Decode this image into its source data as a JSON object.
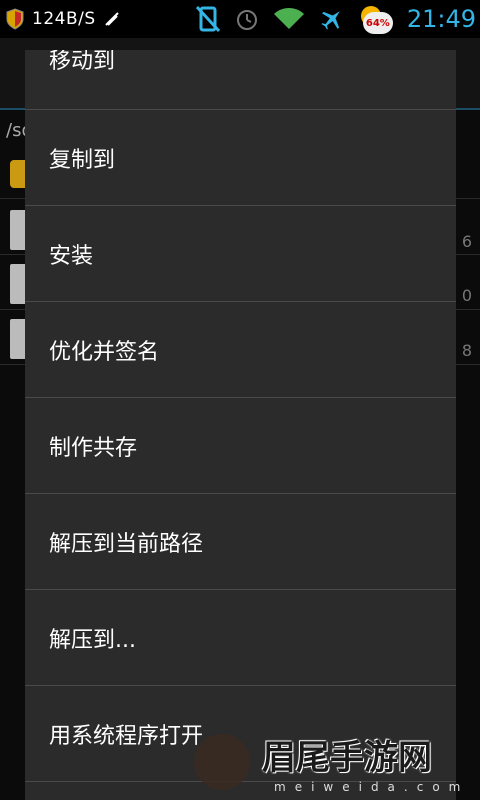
{
  "status_bar": {
    "net_speed": "124B/S",
    "battery_percent": "64%",
    "time": "21:49",
    "icons": [
      "shield-icon",
      "image-icon",
      "usb-icon",
      "mute-icon",
      "alarm-icon",
      "wifi-icon",
      "airplane-icon",
      "weather-icon"
    ],
    "time_color": "#33b5e5"
  },
  "background": {
    "path": "/sd",
    "sizes": [
      "6",
      "0",
      "8"
    ]
  },
  "menu": {
    "items": [
      "移动到",
      "复制到",
      "安装",
      "优化并签名",
      "制作共存",
      "解压到当前路径",
      "解压到...",
      "用系统程序打开"
    ]
  },
  "watermark": {
    "title": "眉尾手游网",
    "subtitle": "meiweida.com"
  }
}
